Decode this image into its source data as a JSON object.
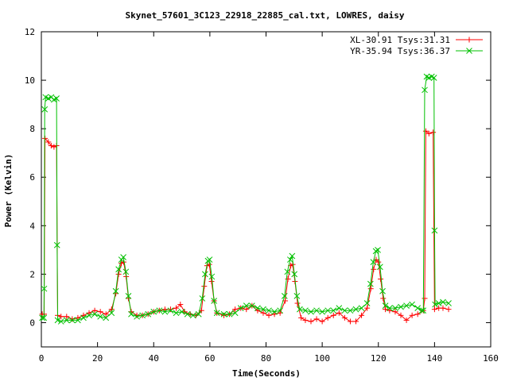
{
  "chart_data": {
    "type": "line",
    "title": "Skynet_57601_3C123_22918_22885_cal.txt, LOWRES, daisy",
    "xlabel": "Time(Seconds)",
    "ylabel": "Power (Kelvin)",
    "xlim": [
      0,
      160
    ],
    "ylim": [
      -1,
      12
    ],
    "xticks": [
      0,
      20,
      40,
      60,
      80,
      100,
      120,
      140,
      160
    ],
    "yticks": [
      0,
      2,
      4,
      6,
      8,
      10,
      12
    ],
    "grid": false,
    "legend_position": "top-right",
    "series": [
      {
        "name": "XL-30.91 Tsys:31.31",
        "color": "#ff0000",
        "marker": "plus",
        "points": [
          [
            0.3,
            0.35
          ],
          [
            1.0,
            0.35
          ],
          [
            1.3,
            7.6
          ],
          [
            2.5,
            7.45
          ],
          [
            3.5,
            7.3
          ],
          [
            4.5,
            7.25
          ],
          [
            5.4,
            7.3
          ],
          [
            5.8,
            0.3
          ],
          [
            7,
            0.25
          ],
          [
            9,
            0.25
          ],
          [
            11,
            0.15
          ],
          [
            13,
            0.2
          ],
          [
            15,
            0.3
          ],
          [
            17,
            0.4
          ],
          [
            19,
            0.5
          ],
          [
            21,
            0.45
          ],
          [
            23,
            0.35
          ],
          [
            25,
            0.55
          ],
          [
            26.5,
            1.2
          ],
          [
            27.5,
            2.0
          ],
          [
            28.5,
            2.45
          ],
          [
            29.3,
            2.5
          ],
          [
            30.2,
            1.9
          ],
          [
            31,
            1.0
          ],
          [
            32,
            0.45
          ],
          [
            34,
            0.3
          ],
          [
            36,
            0.3
          ],
          [
            38,
            0.35
          ],
          [
            40,
            0.45
          ],
          [
            42,
            0.5
          ],
          [
            44,
            0.55
          ],
          [
            46,
            0.55
          ],
          [
            48,
            0.6
          ],
          [
            49.5,
            0.75
          ],
          [
            51,
            0.45
          ],
          [
            53,
            0.35
          ],
          [
            55,
            0.3
          ],
          [
            57,
            0.5
          ],
          [
            58,
            1.5
          ],
          [
            59,
            2.35
          ],
          [
            59.8,
            2.4
          ],
          [
            60.6,
            1.7
          ],
          [
            61.5,
            0.9
          ],
          [
            62.5,
            0.4
          ],
          [
            65,
            0.3
          ],
          [
            67,
            0.35
          ],
          [
            69,
            0.55
          ],
          [
            71,
            0.6
          ],
          [
            73,
            0.55
          ],
          [
            75,
            0.7
          ],
          [
            77,
            0.5
          ],
          [
            79,
            0.4
          ],
          [
            81,
            0.3
          ],
          [
            83,
            0.35
          ],
          [
            85,
            0.4
          ],
          [
            86.8,
            0.9
          ],
          [
            87.8,
            1.8
          ],
          [
            88.8,
            2.35
          ],
          [
            89.5,
            2.4
          ],
          [
            90.3,
            1.7
          ],
          [
            91.2,
            0.8
          ],
          [
            92.5,
            0.2
          ],
          [
            94,
            0.1
          ],
          [
            96,
            0.05
          ],
          [
            98,
            0.15
          ],
          [
            100,
            0.05
          ],
          [
            102,
            0.2
          ],
          [
            104,
            0.3
          ],
          [
            106,
            0.4
          ],
          [
            108,
            0.2
          ],
          [
            110,
            0.05
          ],
          [
            112,
            0.05
          ],
          [
            114,
            0.3
          ],
          [
            116,
            0.6
          ],
          [
            117.3,
            1.4
          ],
          [
            118.3,
            2.2
          ],
          [
            119.2,
            2.6
          ],
          [
            120,
            2.5
          ],
          [
            120.8,
            1.8
          ],
          [
            121.7,
            1.0
          ],
          [
            122.5,
            0.55
          ],
          [
            124,
            0.5
          ],
          [
            126,
            0.45
          ],
          [
            128,
            0.3
          ],
          [
            130,
            0.1
          ],
          [
            132,
            0.3
          ],
          [
            134,
            0.35
          ],
          [
            136,
            0.5
          ],
          [
            136.5,
            1.0
          ],
          [
            136.9,
            7.9
          ],
          [
            138,
            7.8
          ],
          [
            139.5,
            7.85
          ],
          [
            140,
            0.55
          ],
          [
            141.5,
            0.6
          ],
          [
            143,
            0.6
          ],
          [
            145,
            0.55
          ]
        ]
      },
      {
        "name": "YR-35.94 Tsys:36.37",
        "color": "#00c000",
        "marker": "cross",
        "points": [
          [
            0.3,
            0.2
          ],
          [
            0.9,
            0.2
          ],
          [
            1.0,
            1.4
          ],
          [
            1.2,
            8.8
          ],
          [
            1.5,
            9.3
          ],
          [
            2.5,
            9.25
          ],
          [
            3.5,
            9.3
          ],
          [
            4.5,
            9.2
          ],
          [
            5.4,
            9.25
          ],
          [
            5.6,
            3.2
          ],
          [
            5.8,
            0.1
          ],
          [
            7,
            0.05
          ],
          [
            9,
            0.1
          ],
          [
            11,
            0.1
          ],
          [
            13,
            0.1
          ],
          [
            15,
            0.2
          ],
          [
            17,
            0.3
          ],
          [
            19,
            0.35
          ],
          [
            21,
            0.25
          ],
          [
            23,
            0.2
          ],
          [
            25,
            0.4
          ],
          [
            26.5,
            1.3
          ],
          [
            27.5,
            2.2
          ],
          [
            28.5,
            2.6
          ],
          [
            29.2,
            2.7
          ],
          [
            30.1,
            2.1
          ],
          [
            31,
            1.1
          ],
          [
            32,
            0.35
          ],
          [
            34,
            0.25
          ],
          [
            36,
            0.3
          ],
          [
            38,
            0.35
          ],
          [
            40,
            0.45
          ],
          [
            42,
            0.5
          ],
          [
            44,
            0.45
          ],
          [
            46,
            0.5
          ],
          [
            48,
            0.4
          ],
          [
            50,
            0.45
          ],
          [
            52,
            0.35
          ],
          [
            54,
            0.3
          ],
          [
            56,
            0.35
          ],
          [
            57.3,
            1.0
          ],
          [
            58.3,
            2.0
          ],
          [
            59.3,
            2.55
          ],
          [
            59.9,
            2.6
          ],
          [
            60.7,
            1.9
          ],
          [
            61.5,
            0.9
          ],
          [
            62.5,
            0.4
          ],
          [
            65,
            0.35
          ],
          [
            67,
            0.35
          ],
          [
            69,
            0.4
          ],
          [
            71,
            0.6
          ],
          [
            73,
            0.7
          ],
          [
            75,
            0.7
          ],
          [
            77,
            0.6
          ],
          [
            79,
            0.55
          ],
          [
            81,
            0.5
          ],
          [
            83,
            0.45
          ],
          [
            85,
            0.5
          ],
          [
            86.6,
            1.1
          ],
          [
            87.6,
            2.1
          ],
          [
            88.6,
            2.6
          ],
          [
            89.3,
            2.75
          ],
          [
            90.1,
            2.0
          ],
          [
            91,
            1.1
          ],
          [
            92,
            0.55
          ],
          [
            94,
            0.5
          ],
          [
            96,
            0.45
          ],
          [
            98,
            0.5
          ],
          [
            100,
            0.45
          ],
          [
            102,
            0.5
          ],
          [
            104,
            0.5
          ],
          [
            106,
            0.6
          ],
          [
            108,
            0.5
          ],
          [
            110,
            0.5
          ],
          [
            112,
            0.55
          ],
          [
            114,
            0.6
          ],
          [
            116,
            0.8
          ],
          [
            117.2,
            1.6
          ],
          [
            118.2,
            2.5
          ],
          [
            119.1,
            2.95
          ],
          [
            119.8,
            3.0
          ],
          [
            120.6,
            2.3
          ],
          [
            121.5,
            1.3
          ],
          [
            122.5,
            0.7
          ],
          [
            124,
            0.6
          ],
          [
            126,
            0.6
          ],
          [
            128,
            0.65
          ],
          [
            130,
            0.7
          ],
          [
            132,
            0.75
          ],
          [
            134,
            0.6
          ],
          [
            135.5,
            0.5
          ],
          [
            136,
            0.5
          ],
          [
            136.5,
            9.6
          ],
          [
            137.2,
            10.15
          ],
          [
            138,
            10.1
          ],
          [
            139,
            10.15
          ],
          [
            139.8,
            10.1
          ],
          [
            140,
            3.8
          ],
          [
            140.2,
            0.75
          ],
          [
            141.5,
            0.8
          ],
          [
            143,
            0.85
          ],
          [
            145,
            0.8
          ]
        ]
      }
    ]
  }
}
